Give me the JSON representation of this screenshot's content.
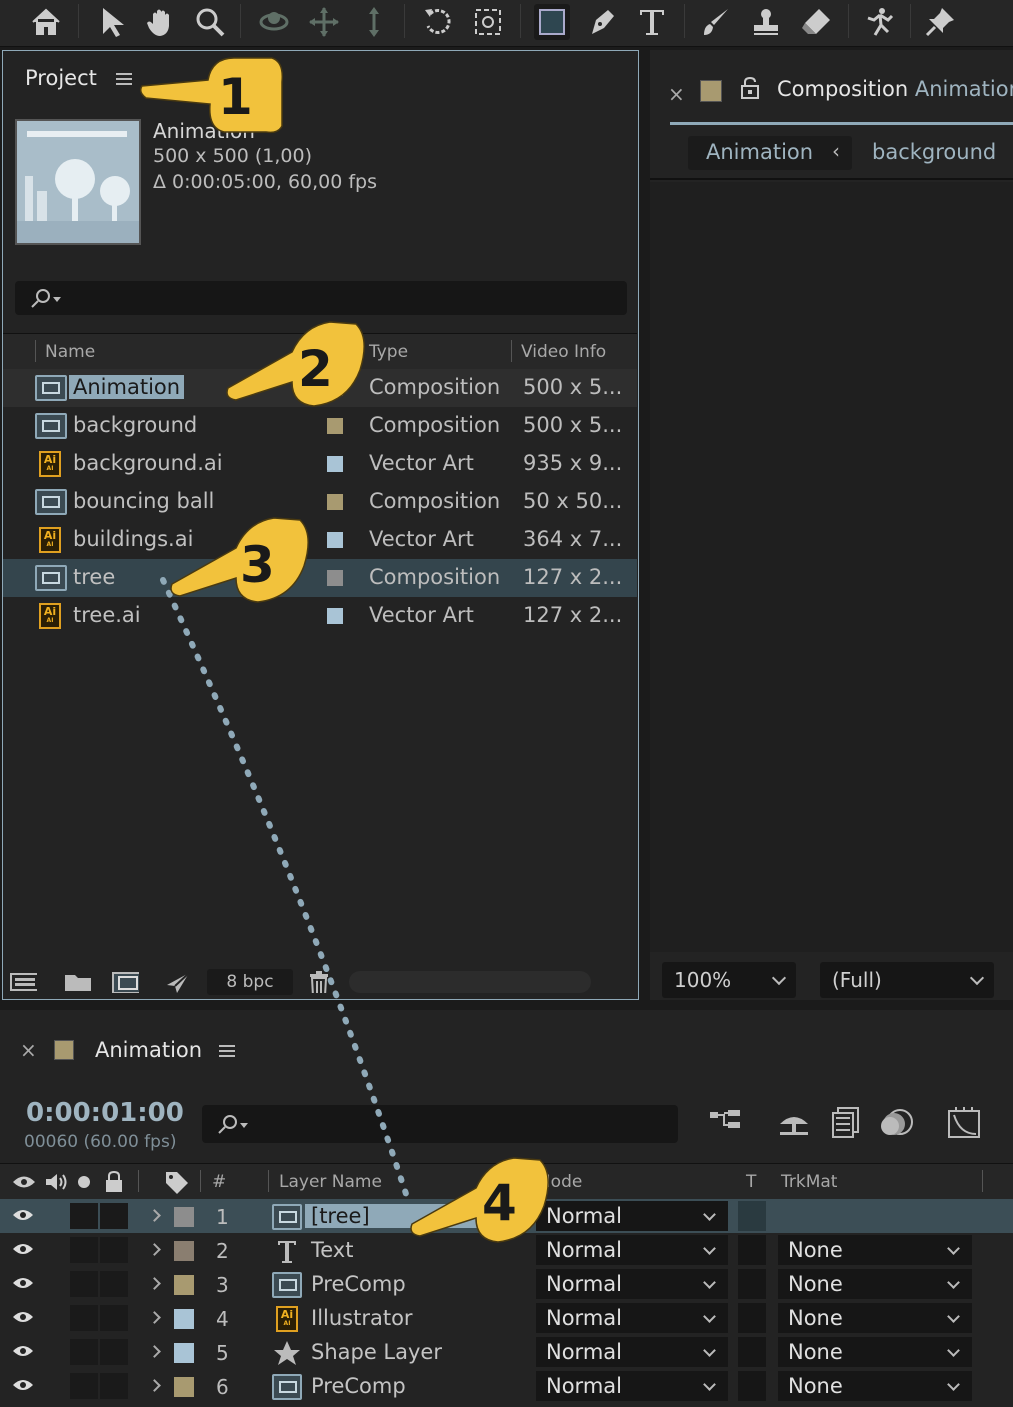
{
  "toolbar": {
    "tools": [
      "home-icon",
      "selection-tool-icon",
      "hand-tool-icon",
      "zoom-tool-icon",
      "orbit-camera-icon",
      "pan-camera-icon",
      "dolly-camera-icon",
      "rotate-tool-icon",
      "pan-behind-icon",
      "rectangle-tool-icon",
      "pen-tool-icon",
      "type-tool-icon",
      "brush-tool-icon",
      "clone-stamp-icon",
      "eraser-tool-icon",
      "puppet-tool-icon",
      "pin-tool-icon"
    ]
  },
  "project": {
    "title": "Project",
    "selected_name": "Animation",
    "selected_size": "500 x 500 (1,00)",
    "selected_duration": "Δ 0:00:05:00, 60,00 fps",
    "columns": {
      "name": "Name",
      "type": "Type",
      "video_info": "Video Info"
    },
    "items": [
      {
        "name": "Animation",
        "type": "Composition",
        "video_info": "500 x 5...",
        "icon": "composition-icon",
        "swatch": "#a89a70",
        "selected": true
      },
      {
        "name": "background",
        "type": "Composition",
        "video_info": "500 x 5...",
        "icon": "composition-icon",
        "swatch": "#a89a70"
      },
      {
        "name": "background.ai",
        "type": "Vector Art",
        "video_info": "935 x 9...",
        "icon": "illustrator-file-icon",
        "swatch": "#a9c4d6"
      },
      {
        "name": "bouncing ball",
        "type": "Composition",
        "video_info": "50 x 50...",
        "icon": "composition-icon",
        "swatch": "#a89a70"
      },
      {
        "name": "buildings.ai",
        "type": "Vector Art",
        "video_info": "364 x 7...",
        "icon": "illustrator-file-icon",
        "swatch": "#a9c4d6"
      },
      {
        "name": "tree",
        "type": "Composition",
        "video_info": "127 x 2...",
        "icon": "composition-icon",
        "swatch": "#8d8d8d",
        "selected": true
      },
      {
        "name": "tree.ai",
        "type": "Vector Art",
        "video_info": "127 x 2...",
        "icon": "illustrator-file-icon",
        "swatch": "#a9c4d6"
      }
    ],
    "bpc": "8 bpc"
  },
  "composition": {
    "prefix": "Composition",
    "name": "Animation",
    "breadcrumb": [
      "Animation",
      "background"
    ],
    "zoom": "100%",
    "resolution": "(Full)"
  },
  "timeline": {
    "tab": "Animation",
    "timecode": "0:00:01:00",
    "frames": "00060 (60.00 fps)",
    "headers": {
      "number": "#",
      "layer_name": "Layer Name",
      "mode": "Mode",
      "t": "T",
      "trkmat": "TrkMat"
    },
    "layers": [
      {
        "num": "1",
        "name": "[tree]",
        "mode": "Normal",
        "trkmat": "",
        "icon": "composition-icon",
        "label": "#8d8d8d",
        "selected": true
      },
      {
        "num": "2",
        "name": "Text",
        "mode": "Normal",
        "trkmat": "None",
        "icon": "text-layer-icon",
        "label": "#8a7e70"
      },
      {
        "num": "3",
        "name": "PreComp",
        "mode": "Normal",
        "trkmat": "None",
        "icon": "composition-icon",
        "label": "#a89a70"
      },
      {
        "num": "4",
        "name": "Illustrator",
        "mode": "Normal",
        "trkmat": "None",
        "icon": "illustrator-file-icon",
        "label": "#a9c4d6"
      },
      {
        "num": "5",
        "name": "Shape Layer",
        "mode": "Normal",
        "trkmat": "None",
        "icon": "star-shape-icon",
        "label": "#a9c4d6"
      },
      {
        "num": "6",
        "name": "PreComp",
        "mode": "Normal",
        "trkmat": "None",
        "icon": "composition-icon",
        "label": "#a89a70"
      }
    ]
  },
  "annotations": [
    "1",
    "2",
    "3",
    "4"
  ],
  "colors": {
    "accent_gold": "#f2c23c",
    "selection_blue": "#8fa9b8",
    "panel_bg": "#232323"
  }
}
